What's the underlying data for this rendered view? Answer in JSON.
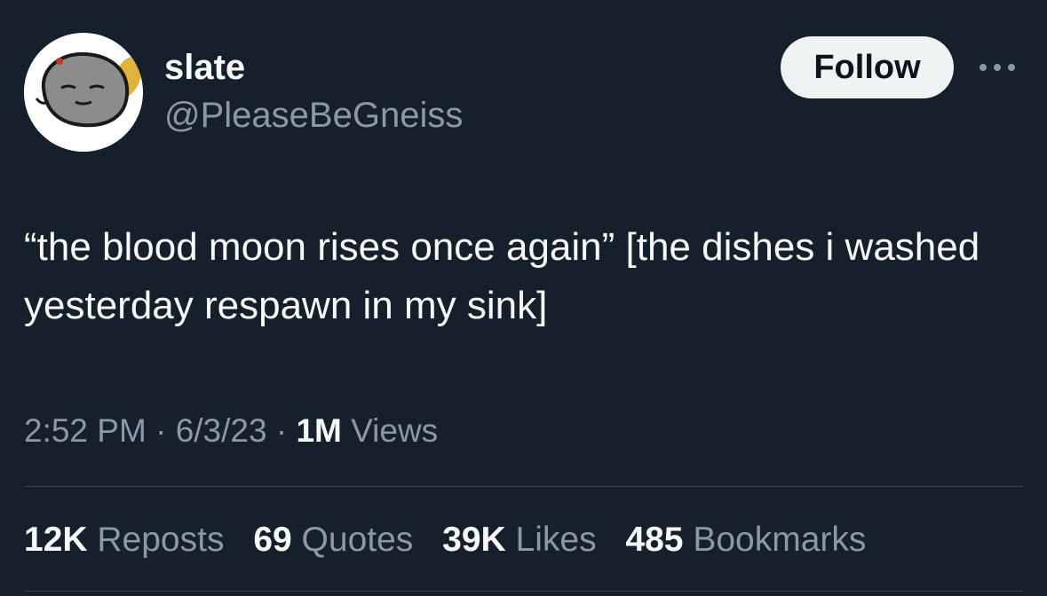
{
  "author": {
    "display_name": "slate",
    "handle": "@PleaseBeGneiss",
    "avatar_icon": "rock-character-avatar"
  },
  "actions": {
    "follow_label": "Follow",
    "more_icon": "more-dots-icon"
  },
  "tweet": {
    "text": "“the blood moon rises once again” [the dishes i washed yesterday respawn in my sink]",
    "time": "2:52 PM",
    "date": "6/3/23",
    "views_count": "1M",
    "views_label": "Views",
    "separator": "·"
  },
  "stats": {
    "reposts": {
      "count": "12K",
      "label": "Reposts"
    },
    "quotes": {
      "count": "69",
      "label": "Quotes"
    },
    "likes": {
      "count": "39K",
      "label": "Likes"
    },
    "bookmarks": {
      "count": "485",
      "label": "Bookmarks"
    }
  },
  "colors": {
    "background": "#15202b",
    "primary_text": "#f7f9f9",
    "secondary_text": "#8b98a5",
    "follow_button_bg": "#eff3f4",
    "divider": "#38444d"
  }
}
